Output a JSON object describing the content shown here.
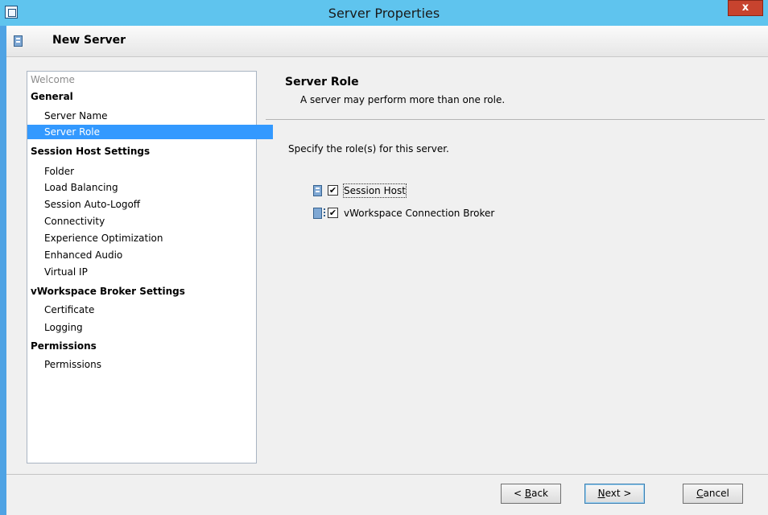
{
  "window": {
    "title": "Server Properties",
    "close_label": "x"
  },
  "header": {
    "title": "New Server"
  },
  "nav": {
    "welcome": "Welcome",
    "sections": [
      {
        "label": "General",
        "items": [
          "Server Name",
          "Server Role"
        ]
      },
      {
        "label": "Session Host Settings",
        "items": [
          "Folder",
          "Load Balancing",
          "Session Auto-Logoff",
          "Connectivity",
          "Experience Optimization",
          "Enhanced Audio",
          "Virtual IP"
        ]
      },
      {
        "label": "vWorkspace Broker Settings",
        "items": [
          "Certificate",
          "Logging"
        ]
      },
      {
        "label": "Permissions",
        "items": [
          "Permissions"
        ]
      }
    ],
    "selected": "Server Role"
  },
  "content": {
    "title": "Server Role",
    "description": "A server may perform more than one role.",
    "instruction": "Specify the role(s) for this server.",
    "roles": [
      {
        "label": "Session Host",
        "checked": true,
        "check_glyph": "✔"
      },
      {
        "label": "vWorkspace Connection Broker",
        "checked": true,
        "check_glyph": "✔"
      }
    ]
  },
  "buttons": {
    "back": {
      "mnemonic": "B",
      "rest": "ack",
      "prefix": "< "
    },
    "next": {
      "mnemonic": "N",
      "rest": "ext",
      "suffix": " >"
    },
    "cancel": {
      "mnemonic": "C",
      "rest": "ancel"
    }
  },
  "colors": {
    "titlebar": "#5fc4ee",
    "selection": "#3399ff",
    "close": "#c7432e"
  }
}
